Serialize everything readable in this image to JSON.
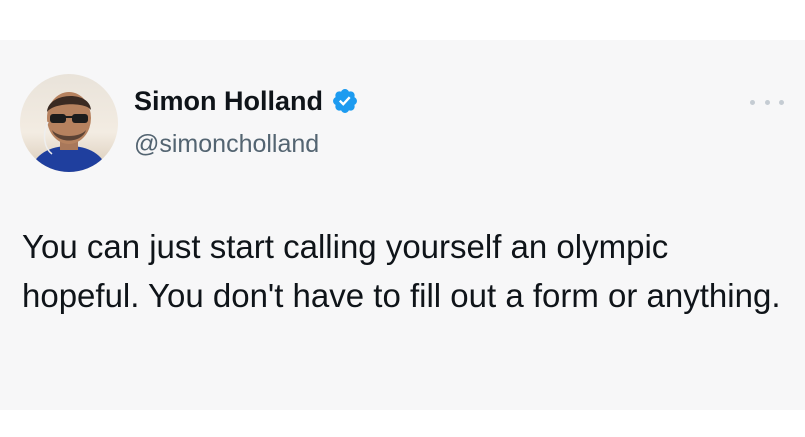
{
  "tweet": {
    "author": {
      "name": "Simon Holland",
      "handle": "@simoncholland",
      "verified": true,
      "avatar_icon": "avatar-photo",
      "verified_icon": "verified-badge-icon",
      "verified_color": "#1d9bf0"
    },
    "more_icon": "more-options-icon",
    "text": "You can just start calling yourself an olympic hopeful. You don't have to fill out a form or anything."
  }
}
